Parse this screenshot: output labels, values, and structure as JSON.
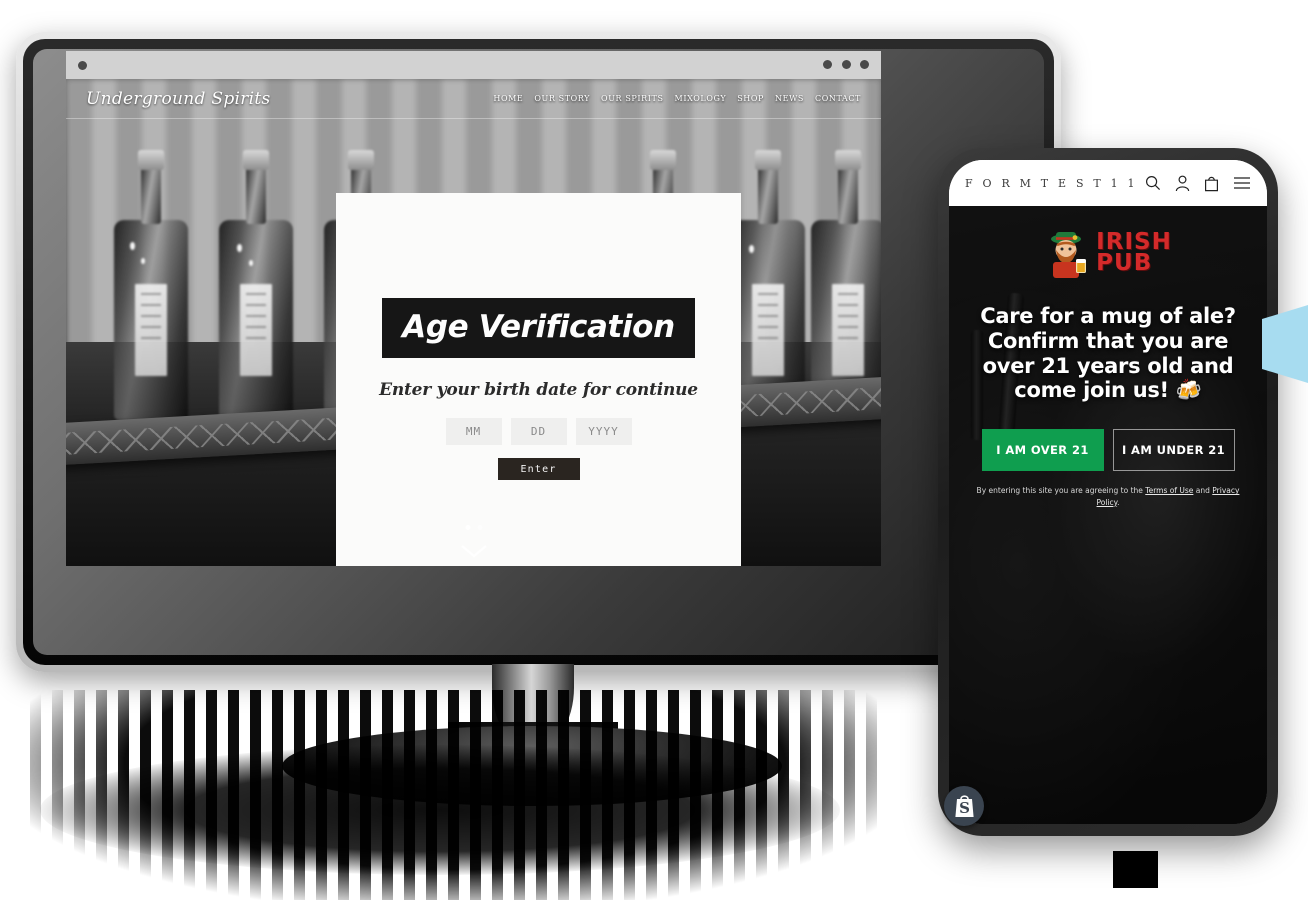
{
  "scene": {
    "description": "Age verification popup mockup shown on a desktop monitor and a mobile phone"
  },
  "desktop": {
    "browser": {
      "left_dot": "window-dot",
      "right_dots": [
        "dot",
        "dot",
        "dot"
      ]
    },
    "site": {
      "brand": "Underground Spirits",
      "nav": [
        "HOME",
        "OUR STORY",
        "OUR SPIRITS",
        "MIXOLOGY",
        "SHOP",
        "NEWS",
        "CONTACT"
      ]
    },
    "age_gate": {
      "title": "Age Verification",
      "subtitle": "Enter your birth date for continue",
      "fields": [
        {
          "name": "month",
          "placeholder": "MM",
          "value": ""
        },
        {
          "name": "day",
          "placeholder": "DD",
          "value": ""
        },
        {
          "name": "year",
          "placeholder": "YYYY",
          "value": ""
        }
      ],
      "submit_label": "Enter"
    },
    "carousel": {
      "slides": 2,
      "active": 1
    }
  },
  "mobile": {
    "header": {
      "store_name": "F O R M T E S T 1 1",
      "icons": [
        "search-icon",
        "account-icon",
        "cart-icon",
        "hamburger-menu-icon"
      ]
    },
    "age_gate": {
      "logo_text_line1": "IRISH",
      "logo_text_line2": "PUB",
      "message": "Care for a mug of ale? Confirm that you are over 21 years old and come join us! 🍻",
      "button_over": "I AM OVER 21",
      "button_under": "I AM UNDER 21",
      "legal_prefix": "By entering this site you are agreeing to the ",
      "legal_link1": "Terms of Use",
      "legal_middle": " and ",
      "legal_link2": "Privacy Policy",
      "legal_suffix": "."
    },
    "badge": "shopify-logo"
  },
  "colors": {
    "accent_green": "#0f9e4f",
    "logo_red": "#d42a2a",
    "modal_bg": "#fbfbfa",
    "title_bg": "#161616",
    "enter_btn": "#2a2520",
    "blue_shape": "#a7dcf0"
  }
}
